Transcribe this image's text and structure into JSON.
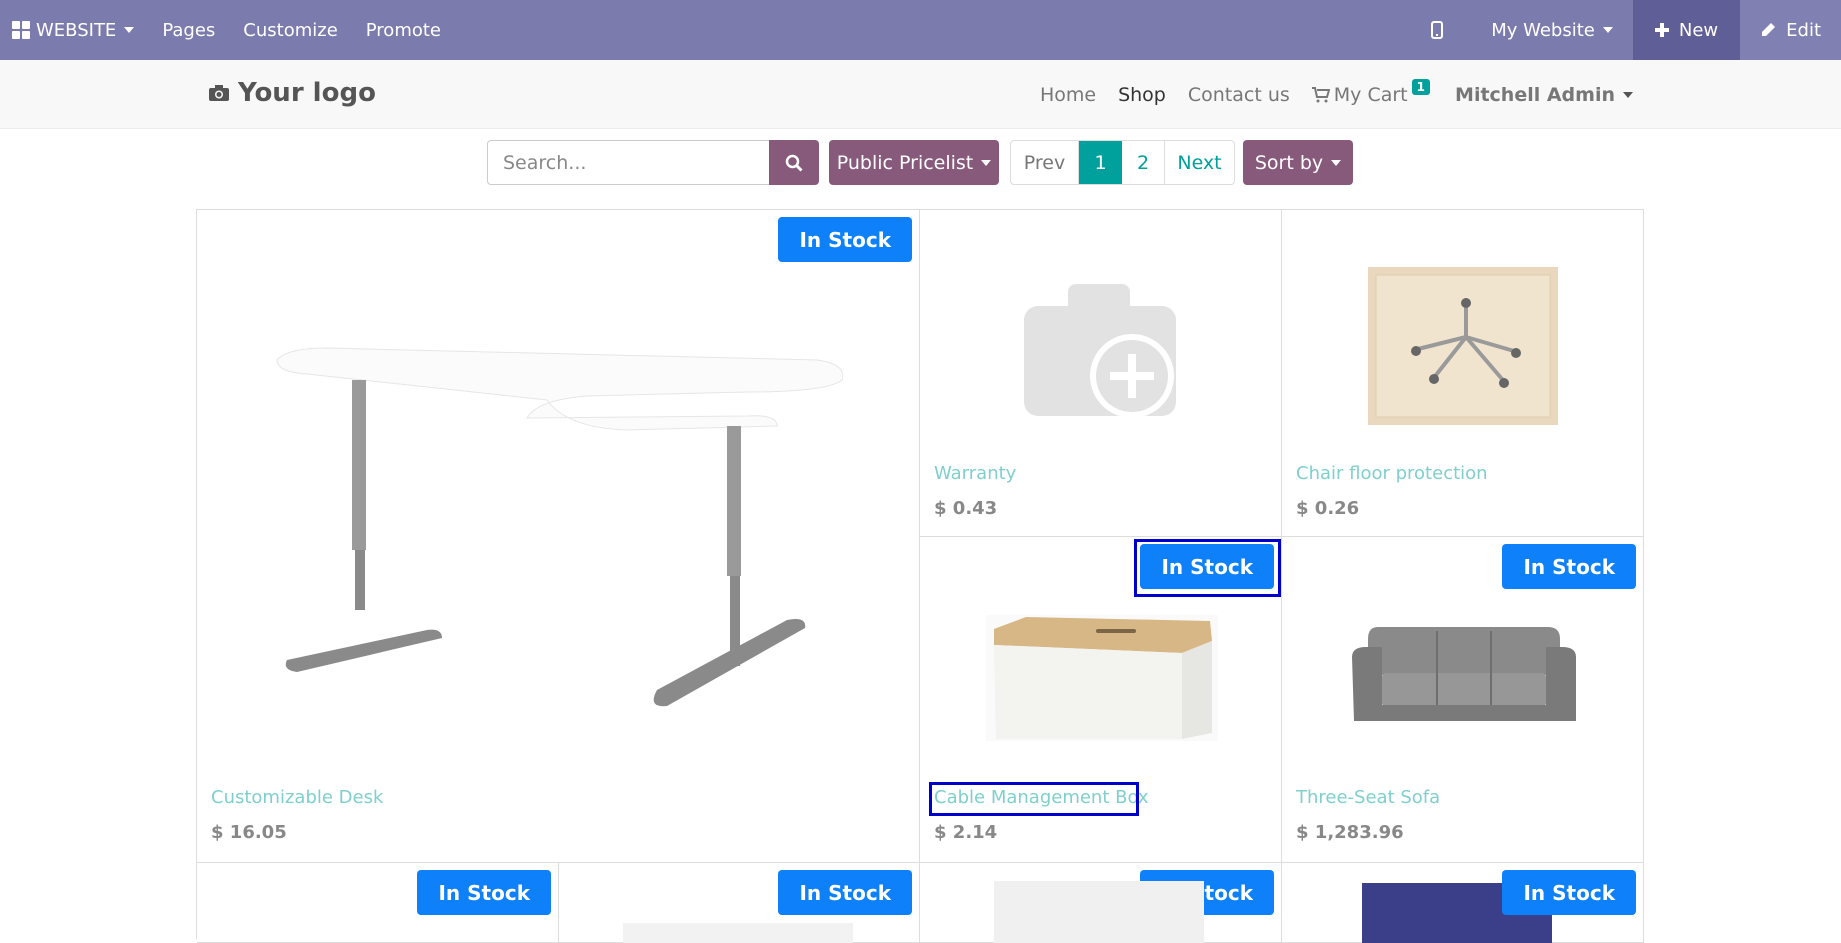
{
  "topbar": {
    "brand": "WEBSITE",
    "menu": [
      "Pages",
      "Customize",
      "Promote"
    ],
    "site_selector": "My Website",
    "new_label": "New",
    "edit_label": "Edit",
    "color": "#7c7bad"
  },
  "header": {
    "logo_text": "Your logo",
    "nav": [
      "Home",
      "Shop",
      "Contact us"
    ],
    "active_nav": "Shop",
    "cart_label": "My Cart",
    "cart_count": "1",
    "user": "Mitchell Admin"
  },
  "filters": {
    "search_placeholder": "Search...",
    "pricelist": "Public Pricelist",
    "pager": {
      "prev": "Prev",
      "pages": [
        "1",
        "2"
      ],
      "current": "1",
      "next": "Next"
    },
    "sort_label": "Sort by"
  },
  "products": [
    {
      "name": "Customizable Desk",
      "price": "$ 16.05",
      "stock": "In Stock",
      "image": "desk"
    },
    {
      "name": "Warranty",
      "price": "$ 0.43",
      "stock": "",
      "image": "camera-placeholder-icon"
    },
    {
      "name": "Chair floor protection",
      "price": "$ 0.26",
      "stock": "",
      "image": "chair-mat"
    },
    {
      "name": "Cable Management Box",
      "price": "$ 2.14",
      "stock": "In Stock",
      "image": "cable-box"
    },
    {
      "name": "Three-Seat Sofa",
      "price": "$ 1,283.96",
      "stock": "In Stock",
      "image": "sofa"
    },
    {
      "name": "",
      "price": "",
      "stock": "In Stock",
      "image": ""
    },
    {
      "name": "",
      "price": "",
      "stock": "In Stock",
      "image": ""
    },
    {
      "name": "",
      "price": "",
      "stock": "In Stock",
      "image": ""
    },
    {
      "name": "",
      "price": "",
      "stock": "In Stock",
      "image": ""
    }
  ],
  "colors": {
    "accent": "#875a7b",
    "teal": "#00a09d",
    "stock_badge": "#0d80fa",
    "highlight": "#0000cc"
  }
}
